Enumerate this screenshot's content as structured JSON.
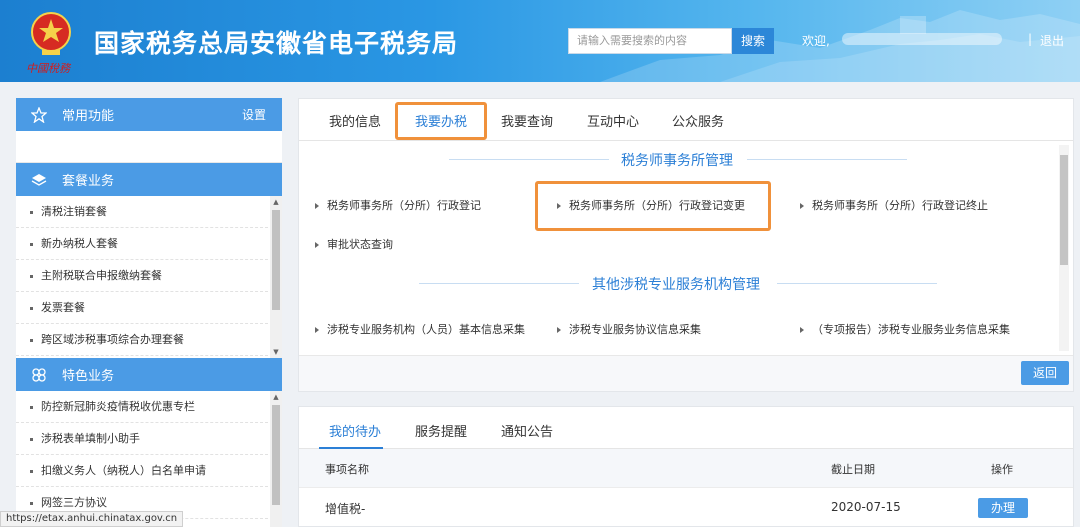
{
  "header": {
    "title": "国家税务总局安徽省电子税务局",
    "emblem_caption": "中國稅務",
    "search_placeholder": "请输入需要搜索的内容",
    "search_button": "搜索",
    "welcome": "欢迎,",
    "divider": "|",
    "logout": "退出"
  },
  "sidebar": {
    "common": {
      "title": "常用功能",
      "settings": "设置"
    },
    "package": {
      "title": "套餐业务",
      "items": [
        "清税注销套餐",
        "新办纳税人套餐",
        "主附税联合申报缴纳套餐",
        "发票套餐",
        "跨区域涉税事项综合办理套餐"
      ]
    },
    "special": {
      "title": "特色业务",
      "items": [
        "防控新冠肺炎疫情税收优惠专栏",
        "涉税表单填制小助手",
        "扣缴义务人（纳税人）白名单申请",
        "网签三方协议"
      ]
    }
  },
  "main": {
    "tabs": [
      "我的信息",
      "我要办税",
      "我要查询",
      "互动中心",
      "公众服务"
    ],
    "active_tab": "我要办税",
    "section1": {
      "title": "税务师事务所管理",
      "links": [
        "税务师事务所（分所）行政登记",
        "税务师事务所（分所）行政登记变更",
        "税务师事务所（分所）行政登记终止",
        "审批状态查询"
      ]
    },
    "section2": {
      "title": "其他涉税专业服务机构管理",
      "links": [
        "涉税专业服务机构（人员）基本信息采集",
        "涉税专业服务协议信息采集",
        "（专项报告）涉税专业服务业务信息采集"
      ]
    },
    "back_button": "返回"
  },
  "todo": {
    "tabs": [
      "我的待办",
      "服务提醒",
      "通知公告"
    ],
    "active_tab": "我的待办",
    "columns": [
      "事项名称",
      "截止日期",
      "操作"
    ],
    "rows": [
      {
        "name": "增值税-",
        "deadline": "2020-07-15",
        "action": "办理"
      }
    ]
  },
  "status_url": "https://etax.anhui.chinatax.gov.cn",
  "colors": {
    "accent": "#2b7fd6",
    "highlight": "#f0913b",
    "sidebar_head": "#4b9be5"
  }
}
